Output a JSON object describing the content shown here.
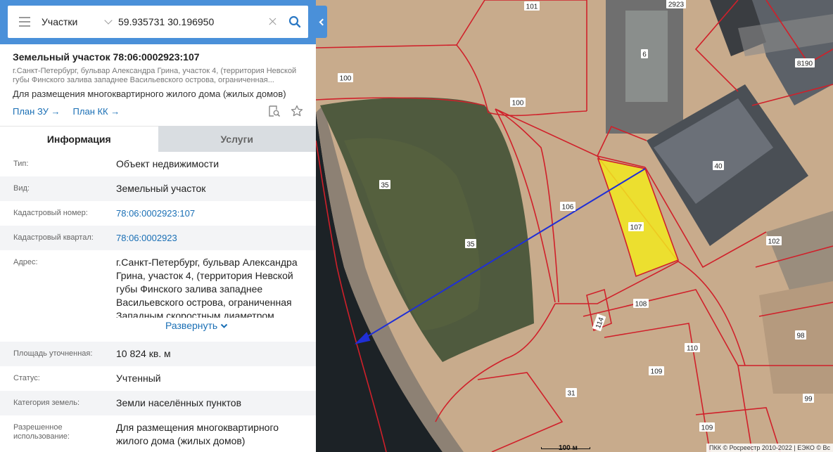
{
  "search": {
    "layer": "Участки",
    "query": "59.935731 30.196950"
  },
  "card": {
    "title": "Земельный участок 78:06:0002923:107",
    "address_short": "г.Санкт-Петербург, бульвар Александра Грина, участок 4, (территория Невской губы Финского залива западнее Васильевского острова, ограниченная...",
    "usage": "Для размещения многоквартирного жилого дома (жилых домов)",
    "link_plan_zu": "План ЗУ →",
    "link_plan_kk": "План КК →"
  },
  "tabs": [
    {
      "label": "Информация",
      "active": true
    },
    {
      "label": "Услуги",
      "active": false
    }
  ],
  "info": {
    "type_label": "Тип:",
    "type_value": "Объект недвижимости",
    "kind_label": "Вид:",
    "kind_value": "Земельный участок",
    "cadnum_label": "Кадастровый номер:",
    "cadnum_value": "78:06:0002923:107",
    "quarter_label": "Кадастровый квартал:",
    "quarter_value": "78:06:0002923",
    "address_label": "Адрес:",
    "address_value": "г.Санкт-Петербург, бульвар Александра Грина, участок 4, (территория Невской губы Финского залива западнее Васильевского острова, ограниченная Западным скоростным диаметром,",
    "expand_label": "Развернуть",
    "area_label": "Площадь уточненная:",
    "area_value": "10 824 кв. м",
    "status_label": "Статус:",
    "status_value": "Учтенный",
    "category_label": "Категория земель:",
    "category_value": "Земли населённых пунктов",
    "permitted_label": "Разрешенное использование:",
    "permitted_value": "Для размещения многоквартирного жилого дома (жилых домов)"
  },
  "map": {
    "plot_numbers": [
      "101",
      "2923",
      "6",
      "8190",
      "100",
      "100",
      "40",
      "35",
      "106",
      "107",
      "102",
      "35",
      "108",
      "114",
      "110",
      "98",
      "109",
      "31",
      "99",
      "109"
    ],
    "scale_label": "100 м",
    "attribution": "ПКК © Росреестр 2010-2022 | ЕЭКО © Вс"
  },
  "colors": {
    "accent": "#4a90d9",
    "link": "#1a6fb5",
    "boundary": "#d0202a",
    "highlight": "#f2e81e",
    "arrow": "#1f2fd6"
  }
}
